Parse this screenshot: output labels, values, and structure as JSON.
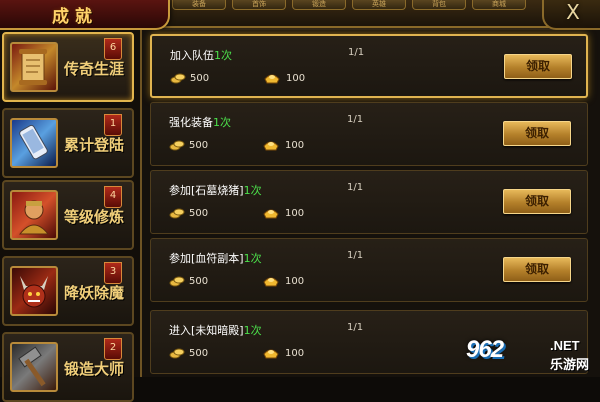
{
  "window": {
    "title": "成就",
    "close_label": "X"
  },
  "top_tabs": [
    "装备",
    "首饰",
    "锻造",
    "英雄",
    "背包",
    "商城"
  ],
  "sidebar": {
    "items": [
      {
        "label": "传奇生涯",
        "badge": "6",
        "icon": "scroll-icon",
        "active": true
      },
      {
        "label": "累计登陆",
        "badge": "1",
        "icon": "phone-icon",
        "active": false
      },
      {
        "label": "等级修炼",
        "badge": "4",
        "icon": "warrior-icon",
        "active": false
      },
      {
        "label": "降妖除魔",
        "badge": "3",
        "icon": "demon-icon",
        "active": false
      },
      {
        "label": "锻造大师",
        "badge": "2",
        "icon": "hammer-icon",
        "active": false
      }
    ]
  },
  "achievements": [
    {
      "name": "加入队伍",
      "count": "1次",
      "progress": "1/1",
      "gold": "500",
      "ingot": "100",
      "claim_label": "领取",
      "active": true,
      "claimable": true
    },
    {
      "name": "强化装备",
      "count": "1次",
      "progress": "1/1",
      "gold": "500",
      "ingot": "100",
      "claim_label": "领取",
      "active": false,
      "claimable": true
    },
    {
      "name": "参加[石墓烧猪]",
      "count": "1次",
      "progress": "1/1",
      "gold": "500",
      "ingot": "100",
      "claim_label": "领取",
      "active": false,
      "claimable": true
    },
    {
      "name": "参加[血符副本]",
      "count": "1次",
      "progress": "1/1",
      "gold": "500",
      "ingot": "100",
      "claim_label": "领取",
      "active": false,
      "claimable": true
    },
    {
      "name": "进入[未知暗殿]",
      "count": "1次",
      "progress": "1/1",
      "gold": "500",
      "ingot": "100",
      "claim_label": "",
      "active": false,
      "claimable": false
    }
  ],
  "watermark": {
    "main": "962",
    "net": ".NET",
    "sub": "乐游网"
  },
  "colors": {
    "accent_gold": "#e0b450",
    "count_green": "#4be04b",
    "badge_red": "#b02a1a"
  }
}
